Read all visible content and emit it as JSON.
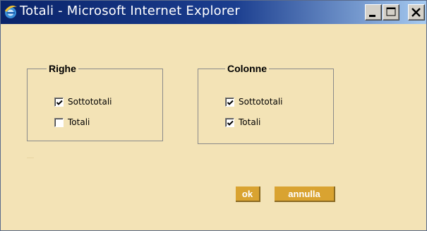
{
  "window": {
    "title": "Totali - Microsoft Internet Explorer",
    "minimize_glyph": "_",
    "maximize_glyph": "□",
    "close_glyph": "X"
  },
  "groups": {
    "rows": {
      "legend": "Righe",
      "subtotals": {
        "label": "Sottototali",
        "checked": true
      },
      "totals": {
        "label": "Totali",
        "checked": false
      }
    },
    "columns": {
      "legend": "Colonne",
      "subtotals": {
        "label": "Sottototali",
        "checked": true
      },
      "totals": {
        "label": "Totali",
        "checked": true
      }
    }
  },
  "buttons": {
    "ok_label": "ok",
    "cancel_label": "annulla"
  },
  "colors": {
    "background": "#f3e3b6",
    "button": "#d9a331",
    "titlebar_start": "#0a246a",
    "titlebar_end": "#a6caf0"
  },
  "icons": {
    "app": "ie-icon",
    "check": "checkmark-icon"
  }
}
